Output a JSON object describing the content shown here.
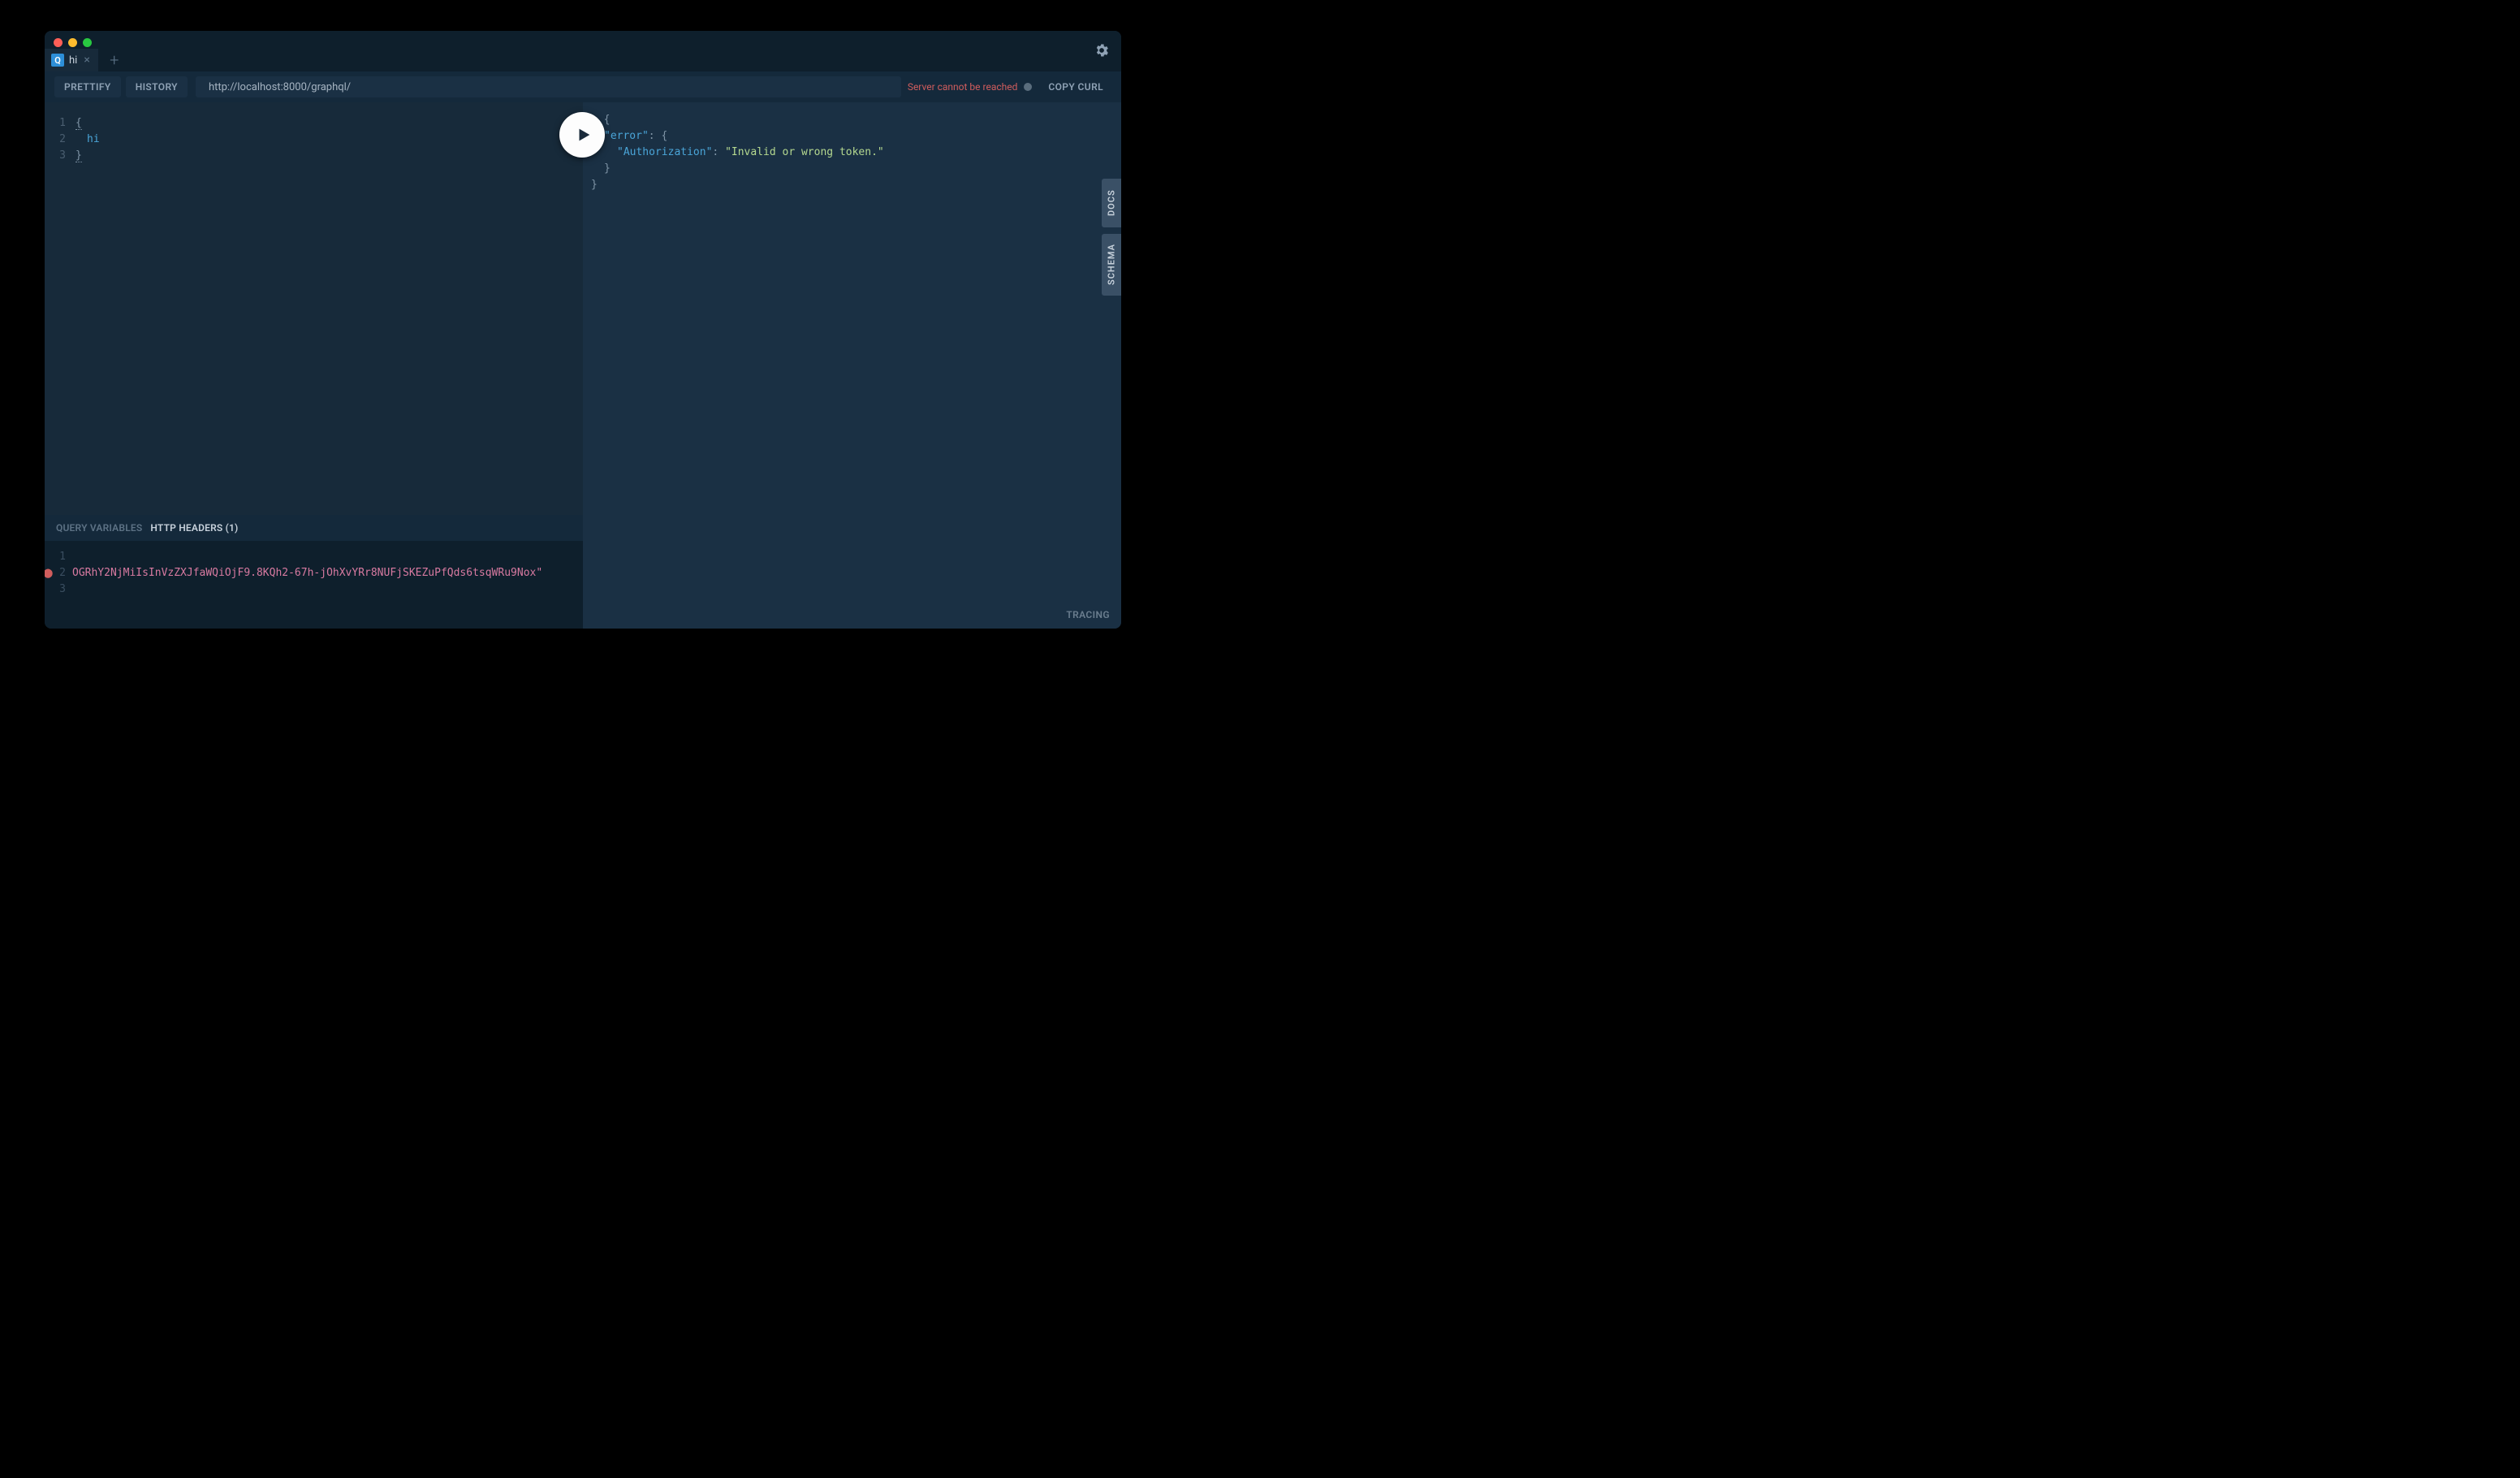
{
  "tab": {
    "icon": "Q",
    "label": "hi"
  },
  "toolbar": {
    "prettify": "PRETTIFY",
    "history": "HISTORY",
    "endpoint": "http://localhost:8000/graphql/",
    "server_status": "Server cannot be reached",
    "copy_curl": "COPY CURL"
  },
  "query": {
    "lines": [
      "1",
      "2",
      "3"
    ],
    "l1": "{",
    "l2": "hi",
    "l3": "}"
  },
  "response": {
    "l1": "{",
    "l2_key": "\"error\"",
    "l2_rest": ": {",
    "l3_key": "\"Authorization\"",
    "l3_sep": ": ",
    "l3_val": "\"Invalid or wrong token.\"",
    "l4": "}",
    "l5": "}"
  },
  "bottom": {
    "query_vars": "QUERY VARIABLES",
    "http_headers": "HTTP HEADERS (1)"
  },
  "headers": {
    "lines": [
      "1",
      "2",
      "3"
    ],
    "l2": "OGRhY2NjMiIsInVzZXJfaWQiOjF9.8KQh2-67h-jOhXvYRr8NUFjSKEZuPfQds6tsqWRu9Nox\""
  },
  "side": {
    "docs": "DOCS",
    "schema": "SCHEMA"
  },
  "footer": {
    "tracing": "TRACING"
  }
}
